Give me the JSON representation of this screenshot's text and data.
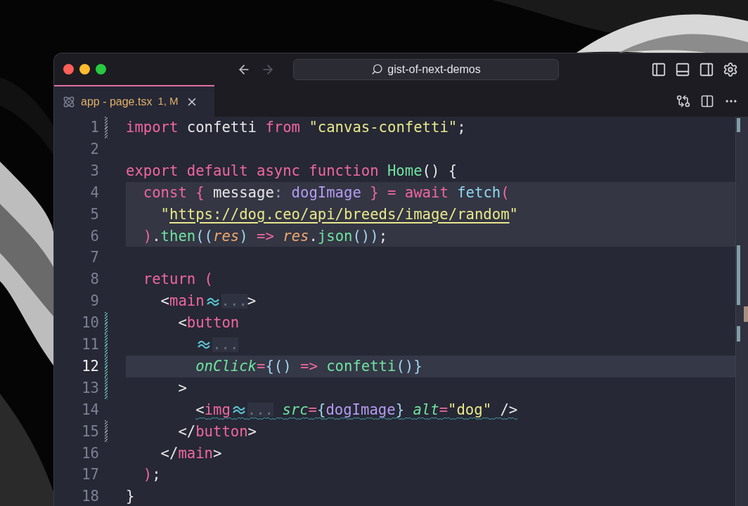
{
  "window": {
    "lights": [
      {
        "color": "#fe5f57"
      },
      {
        "color": "#febc2e"
      },
      {
        "color": "#28c840"
      }
    ],
    "search": {
      "value": "gist-of-next-demos"
    },
    "nav": [
      {
        "kind": "back",
        "disabled": false
      },
      {
        "kind": "forward",
        "disabled": true
      }
    ]
  },
  "tabs": [
    {
      "label": "app - page.tsx",
      "badge": "1, M",
      "selected": true
    }
  ],
  "editor": {
    "lines": [
      {
        "number": "1",
        "selected": false,
        "highlighted": false,
        "changed": true,
        "color": "#8a8f9c",
        "warning": false,
        "tokens": [
          {
            "kind": "keyword",
            "text": "import"
          },
          {
            "kind": "text",
            "text": " confetti "
          },
          {
            "kind": "keyword",
            "text": "from"
          },
          {
            "kind": "string",
            "text": " \"canvas-confetti\""
          },
          {
            "kind": "text",
            "text": ";"
          }
        ]
      },
      {
        "number": "2",
        "selected": false,
        "highlighted": false,
        "changed": false,
        "warning": false
      },
      {
        "number": "3",
        "selected": false,
        "highlighted": false,
        "changed": false,
        "warning": false,
        "tokens": [
          {
            "kind": "keyword",
            "text": "export default async function"
          },
          {
            "kind": "func",
            "text": " Home"
          },
          {
            "kind": "text",
            "text": "() {"
          }
        ],
        "children": [
          {
            "number": "4",
            "selected": false,
            "highlighted": true,
            "changed": false,
            "warning": false,
            "tokens": [
              {
                "kind": "keyword",
                "text": "const { "
              },
              {
                "kind": "text",
                "text": "message"
              },
              {
                "kind": "punct",
                "text": ":"
              },
              {
                "kind": "var",
                "text": " dogImage"
              },
              {
                "kind": "keyword",
                "text": " } = await"
              },
              {
                "kind": "call",
                "text": " fetch"
              },
              {
                "kind": "keyword",
                "text": "("
              }
            ],
            "children": [
              {
                "number": "5",
                "selected": false,
                "highlighted": true,
                "changed": false,
                "warning": false,
                "tokens": [
                  {
                    "kind": "string",
                    "text": "\""
                  },
                  {
                    "kind": "link",
                    "text": "https://dog.ceo/api/breeds/image/random"
                  },
                  {
                    "kind": "string",
                    "text": "\""
                  }
                ]
              }
            ]
          },
          {
            "number": "6",
            "selected": false,
            "highlighted": true,
            "changed": false,
            "warning": false,
            "tokens": [
              {
                "kind": "keyword",
                "text": ")"
              },
              {
                "kind": "text",
                "text": "."
              },
              {
                "kind": "func",
                "text": "then"
              },
              {
                "kind": "brace",
                "text": "(("
              },
              {
                "kind": "param",
                "text": "res"
              },
              {
                "kind": "brace",
                "text": ")"
              },
              {
                "kind": "keyword",
                "text": " => "
              },
              {
                "kind": "param",
                "text": "res"
              },
              {
                "kind": "text",
                "text": "."
              },
              {
                "kind": "func",
                "text": "json"
              },
              {
                "kind": "brace",
                "text": "())"
              },
              {
                "kind": "text",
                "text": ";"
              }
            ]
          },
          {
            "number": "7",
            "selected": false,
            "highlighted": false,
            "changed": false,
            "warning": false
          },
          {
            "number": "8",
            "selected": false,
            "highlighted": false,
            "changed": false,
            "warning": false,
            "tokens": [
              {
                "kind": "keyword",
                "text": "return ("
              }
            ],
            "children": [
              {
                "number": "9",
                "selected": false,
                "highlighted": false,
                "changed": false,
                "warning": false,
                "tokens": [
                  {
                    "kind": "text",
                    "text": "<"
                  },
                  {
                    "kind": "keyword",
                    "text": "main"
                  },
                  {
                    "kind": "fold",
                    "text": "..."
                  },
                  {
                    "kind": "text",
                    "text": ">"
                  }
                ],
                "children": [
                  {
                    "number": "10",
                    "selected": false,
                    "highlighted": false,
                    "changed": true,
                    "color": "#5fa8a8",
                    "warning": false,
                    "tokens": [
                      {
                        "kind": "text",
                        "text": "<"
                      },
                      {
                        "kind": "keyword",
                        "text": "button"
                      }
                    ],
                    "children": [
                      {
                        "number": "11",
                        "selected": false,
                        "highlighted": false,
                        "changed": true,
                        "color": "#5fa8a8",
                        "warning": false,
                        "tokens": [
                          {
                            "kind": "fold",
                            "text": "..."
                          }
                        ]
                      },
                      {
                        "number": "12",
                        "selected": true,
                        "highlighted": false,
                        "changed": true,
                        "color": "#5fa8a8",
                        "warning": false,
                        "tokens": [
                          {
                            "kind": "attr",
                            "text": "onClick"
                          },
                          {
                            "kind": "keyword",
                            "text": "="
                          },
                          {
                            "kind": "brace",
                            "text": "{()"
                          },
                          {
                            "kind": "keyword",
                            "text": " => "
                          },
                          {
                            "kind": "func",
                            "text": "confetti"
                          },
                          {
                            "kind": "brace",
                            "text": "()}"
                          }
                        ]
                      }
                    ]
                  },
                  {
                    "number": "13",
                    "selected": false,
                    "highlighted": false,
                    "changed": true,
                    "color": "#5fa8a8",
                    "warning": false,
                    "tokens": [
                      {
                        "kind": "text",
                        "text": ">"
                      }
                    ],
                    "children": [
                      {
                        "number": "14",
                        "selected": false,
                        "highlighted": false,
                        "changed": false,
                        "warning": true,
                        "tokens": [
                          {
                            "kind": "text",
                            "text": "<"
                          },
                          {
                            "kind": "keyword",
                            "text": "img"
                          },
                          {
                            "kind": "fold",
                            "text": "..."
                          },
                          {
                            "kind": "attr",
                            "text": " src"
                          },
                          {
                            "kind": "keyword",
                            "text": "="
                          },
                          {
                            "kind": "brace",
                            "text": "{"
                          },
                          {
                            "kind": "var",
                            "text": "dogImage"
                          },
                          {
                            "kind": "brace",
                            "text": "}"
                          },
                          {
                            "kind": "attr",
                            "text": " alt"
                          },
                          {
                            "kind": "keyword",
                            "text": "="
                          },
                          {
                            "kind": "string",
                            "text": "\"dog\""
                          },
                          {
                            "kind": "text",
                            "text": " />"
                          }
                        ]
                      }
                    ]
                  },
                  {
                    "number": "15",
                    "selected": false,
                    "highlighted": false,
                    "changed": true,
                    "color": "#8a8f9c",
                    "warning": false,
                    "tokens": [
                      {
                        "kind": "text",
                        "text": "</"
                      },
                      {
                        "kind": "keyword",
                        "text": "button"
                      },
                      {
                        "kind": "text",
                        "text": ">"
                      }
                    ]
                  }
                ]
              },
              {
                "number": "16",
                "selected": false,
                "highlighted": false,
                "changed": false,
                "warning": false,
                "tokens": [
                  {
                    "kind": "text",
                    "text": "</"
                  },
                  {
                    "kind": "keyword",
                    "text": "main"
                  },
                  {
                    "kind": "text",
                    "text": ">"
                  }
                ]
              }
            ]
          },
          {
            "number": "17",
            "selected": false,
            "highlighted": false,
            "changed": false,
            "warning": false,
            "tokens": [
              {
                "kind": "keyword",
                "text": ")"
              },
              {
                "kind": "text",
                "text": ";"
              }
            ]
          }
        ]
      },
      {
        "number": "18",
        "selected": false,
        "highlighted": false,
        "changed": false,
        "tokens": [
          {
            "kind": "text",
            "text": "}"
          }
        ]
      }
    ]
  }
}
